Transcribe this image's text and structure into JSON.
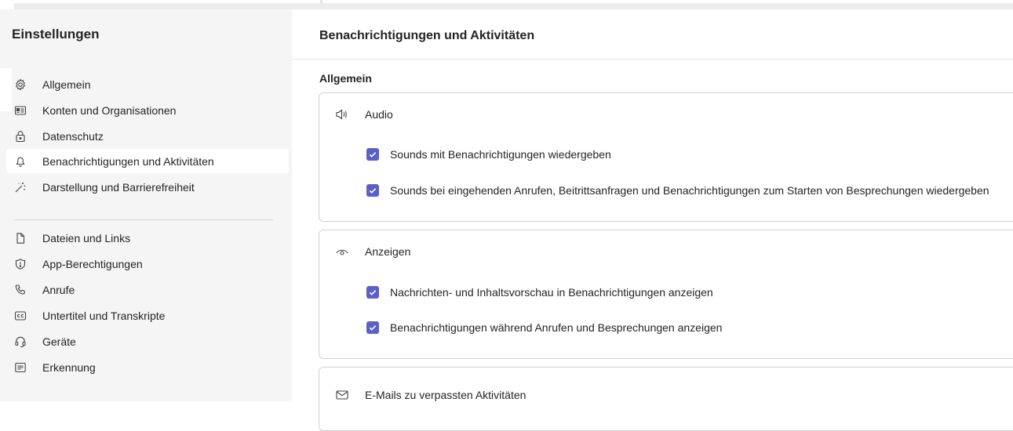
{
  "sidebar": {
    "title": "Einstellungen",
    "items": [
      {
        "label": "Allgemein",
        "icon": "gear-icon"
      },
      {
        "label": "Konten und Organisationen",
        "icon": "id-card-icon"
      },
      {
        "label": "Datenschutz",
        "icon": "lock-icon"
      },
      {
        "label": "Benachrichtigungen und Aktivitäten",
        "icon": "bell-icon",
        "active": true
      },
      {
        "label": "Darstellung und Barrierefreiheit",
        "icon": "magic-wand-icon"
      },
      {
        "label": "Dateien und Links",
        "icon": "document-icon"
      },
      {
        "label": "App-Berechtigungen",
        "icon": "shield-icon"
      },
      {
        "label": "Anrufe",
        "icon": "phone-icon"
      },
      {
        "label": "Untertitel und Transkripte",
        "icon": "closed-captions-icon"
      },
      {
        "label": "Geräte",
        "icon": "headset-icon"
      },
      {
        "label": "Erkennung",
        "icon": "text-box-icon"
      }
    ]
  },
  "main": {
    "title": "Benachrichtigungen und Aktivitäten",
    "section": "Allgemein",
    "cards": [
      {
        "label": "Audio",
        "icon": "speaker-icon",
        "options": [
          {
            "label": "Sounds mit Benachrichtigungen wiedergeben",
            "checked": true
          },
          {
            "label": "Sounds bei eingehenden Anrufen, Beitrittsanfragen und Benachrichtigungen zum Starten von Besprechungen wiedergeben",
            "checked": true
          }
        ]
      },
      {
        "label": "Anzeigen",
        "icon": "eye-icon",
        "options": [
          {
            "label": "Nachrichten- und Inhaltsvorschau in Benachrichtigungen anzeigen",
            "checked": true
          },
          {
            "label": "Benachrichtigungen während Anrufen und Besprechungen anzeigen",
            "checked": true
          }
        ]
      },
      {
        "label": "E-Mails zu verpassten Aktivitäten",
        "icon": "mail-icon",
        "options": []
      }
    ]
  },
  "colors": {
    "accent": "#5b5fc7",
    "sidebar_bg": "#f5f5f5",
    "border": "#d1d1d1"
  }
}
